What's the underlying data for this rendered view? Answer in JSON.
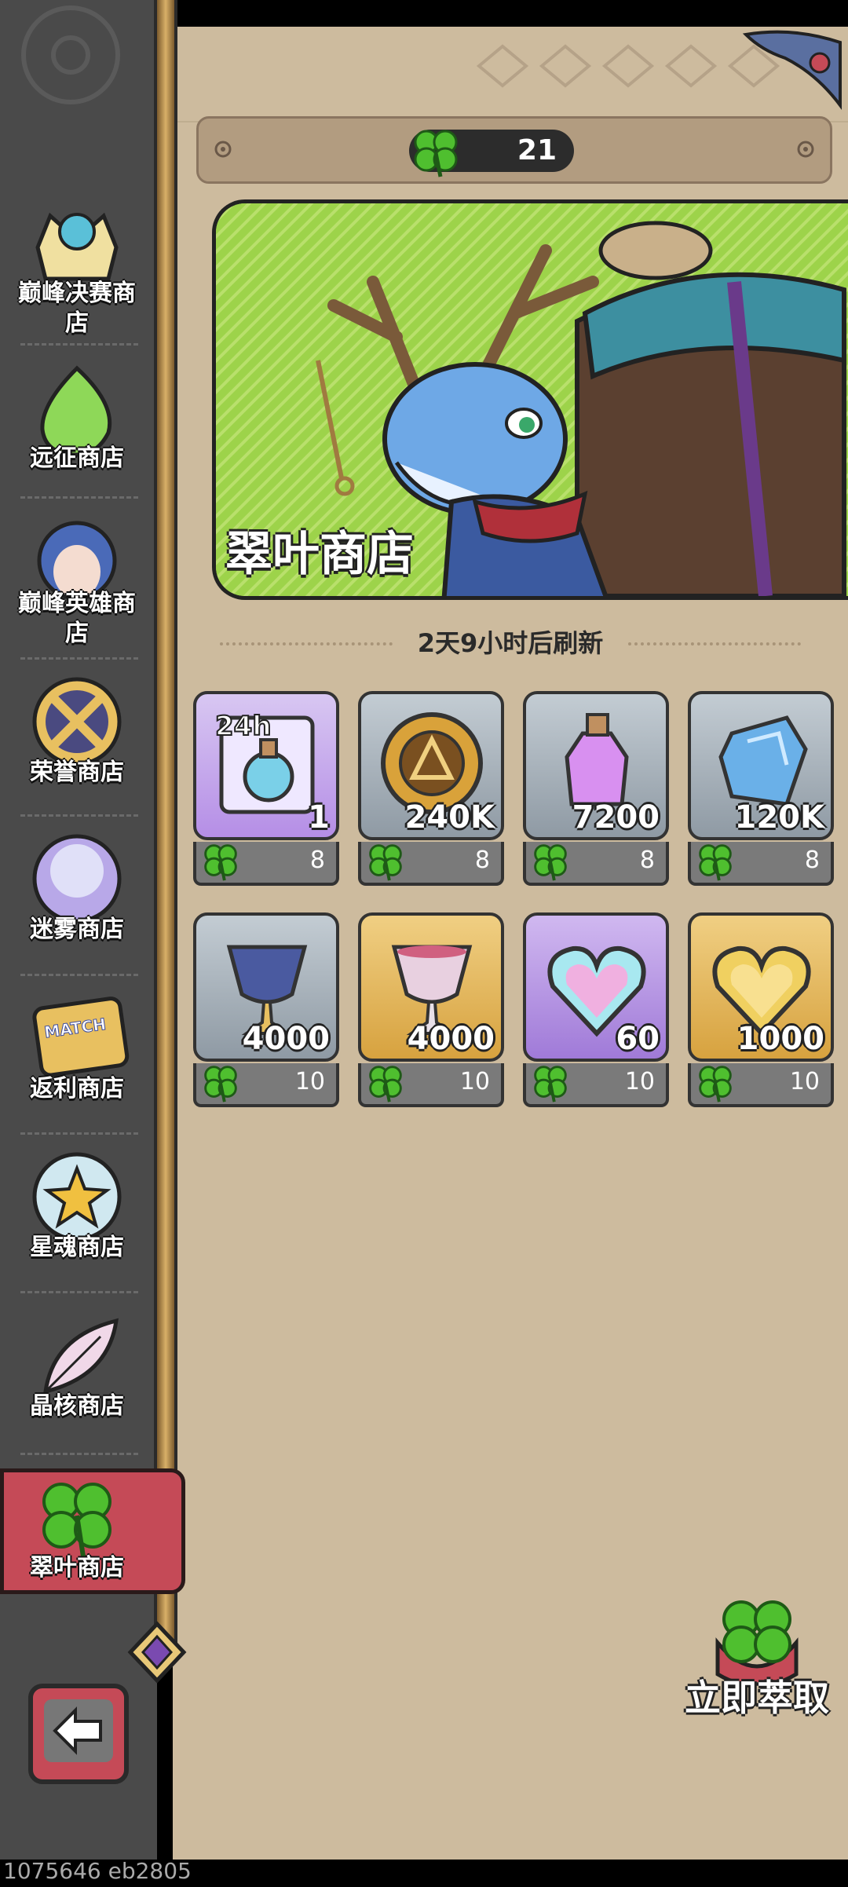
{
  "currency": {
    "amount": "21",
    "icon": "clover-icon"
  },
  "banner": {
    "title": "翠叶商店"
  },
  "refresh": {
    "text": "2天9小时后刷新"
  },
  "items": [
    {
      "qty": "1",
      "price": "8",
      "bg": "purple",
      "icon": "potion-ticket-icon",
      "tag": "24h"
    },
    {
      "qty": "240K",
      "price": "8",
      "bg": "gray",
      "icon": "gold-coin-icon"
    },
    {
      "qty": "7200",
      "price": "8",
      "bg": "gray",
      "icon": "purple-potion-icon"
    },
    {
      "qty": "120K",
      "price": "8",
      "bg": "gray",
      "icon": "blue-crystal-icon"
    },
    {
      "qty": "4000",
      "price": "10",
      "bg": "gray",
      "icon": "blue-chalice-icon"
    },
    {
      "qty": "4000",
      "price": "10",
      "bg": "gold",
      "icon": "pink-chalice-icon"
    },
    {
      "qty": "60",
      "price": "10",
      "bg": "lilac",
      "icon": "crystal-heart-icon"
    },
    {
      "qty": "1000",
      "price": "10",
      "bg": "gold",
      "icon": "golden-heart-icon"
    }
  ],
  "sidebar": {
    "items": [
      {
        "label": "巅峰决赛商店",
        "icon": "crown-icon"
      },
      {
        "label": "远征商店",
        "icon": "slime-icon"
      },
      {
        "label": "巅峰英雄商店",
        "icon": "hero-portrait-icon"
      },
      {
        "label": "荣誉商店",
        "icon": "crossed-swords-icon"
      },
      {
        "label": "迷雾商店",
        "icon": "mist-orb-icon"
      },
      {
        "label": "返利商店",
        "icon": "match-ticket-icon",
        "badge": "MATCH"
      },
      {
        "label": "星魂商店",
        "icon": "star-icon"
      },
      {
        "label": "晶核商店",
        "icon": "feather-icon"
      },
      {
        "label": "翠叶商店",
        "icon": "clover-icon",
        "active": true
      }
    ]
  },
  "extract": {
    "label": "立即萃取"
  },
  "footer": {
    "text": "1075646 eb2805"
  },
  "colors": {
    "panel": "#cdbb9e",
    "sidebar": "#4a4a4a",
    "active": "#c54a57",
    "clover": "#4fbf2f"
  }
}
